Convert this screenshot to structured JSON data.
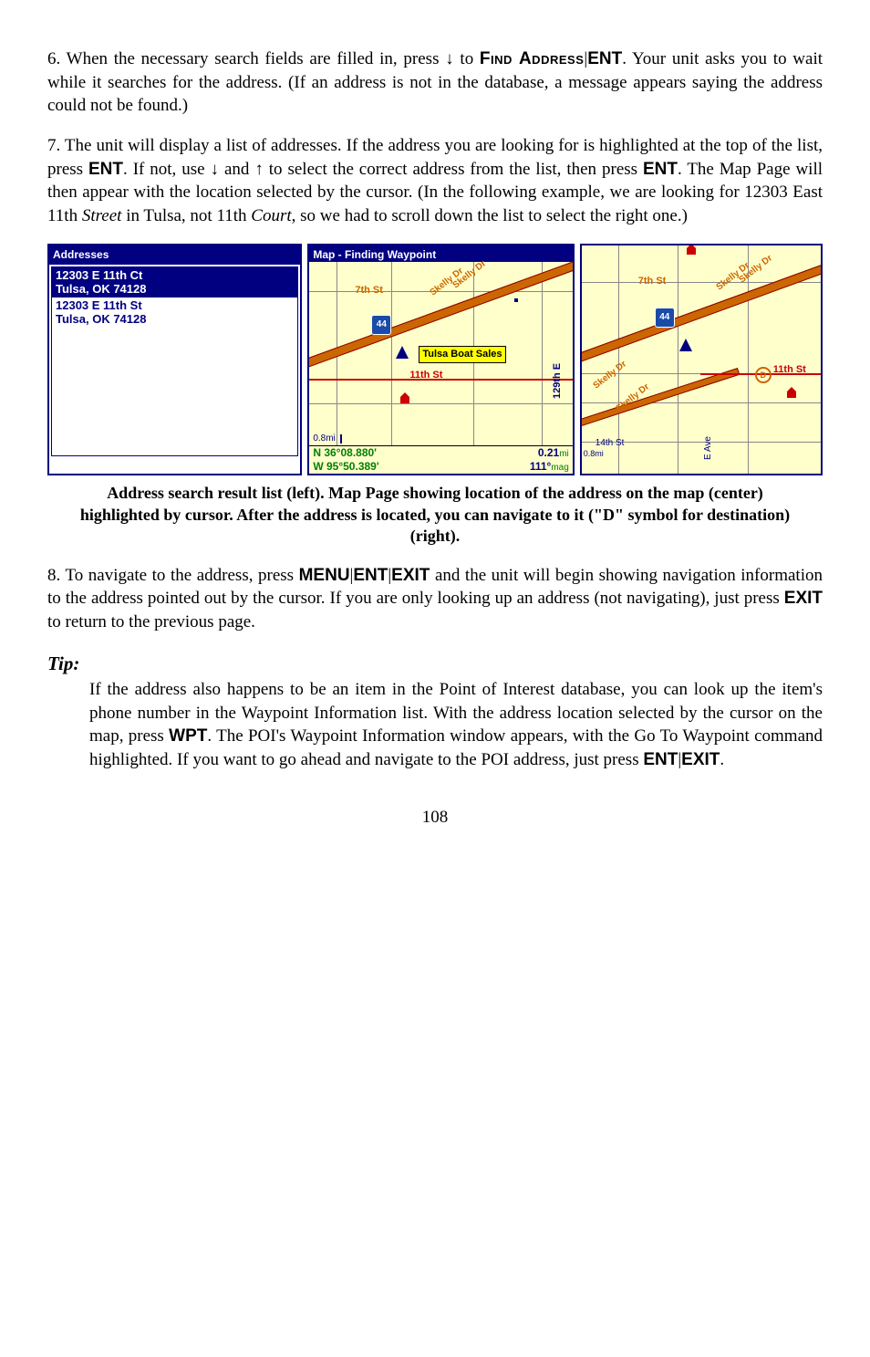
{
  "step6": {
    "prefix": "6. When the necessary search fields are filled in, press ↓ to ",
    "findaddress": "Find Address",
    "ent": "ENT",
    "rest": ". Your unit asks you to wait while it searches for the address. (If an address is not in the database, a message appears saying the address could not be found.)"
  },
  "step7": {
    "part1": "7. The unit will display a list of addresses. If the address you are looking for is highlighted at the top of the list, press ",
    "ent1": "ENT",
    "part2": ". If not, use ↓ and ↑ to select the correct address from the list, then press ",
    "ent2": "ENT",
    "part3": ". The Map Page will then appear with the location selected by the cursor. (In the following example, we are looking for 12303 East 11th ",
    "street": "Street",
    "part4": " in Tulsa, not 11th ",
    "court": "Court",
    "part5": ", so we had to scroll down the list to select the right one.)"
  },
  "fig": {
    "addr_title": "Addresses",
    "sel_line1": "12303 E 11th Ct",
    "sel_line2": "Tulsa, OK  74128",
    "unsel_line1": "12303 E 11th St",
    "unsel_line2": "Tulsa, OK  74128",
    "map_title": "Map - Finding Waypoint",
    "poi": "Tulsa Boat Sales",
    "street11": "11th St",
    "street129": "129th E",
    "street7": "7th St",
    "street14": "14th St",
    "skelly": "Skelly Dr",
    "eave": "E Ave",
    "shield": "44",
    "scale": "0.8mi",
    "coordN": "N    36°08.880'",
    "coordW": "W   95°50.389'",
    "dist": "0.21",
    "dist_unit": "mi",
    "bearing": "111°",
    "bearing_unit": "mag",
    "d_symbol": "D"
  },
  "caption": "Address search result list (left). Map Page showing location of the address on the map (center) highlighted by cursor. After the address is located, you can navigate to it (\"D\" symbol for destination) (right).",
  "step8": {
    "part1": "8. To navigate to the address, press ",
    "menu": "MENU",
    "ent": "ENT",
    "exit1": "EXIT",
    "part2": " and the unit will begin showing navigation information to the address pointed out by the cursor. If you are only looking up an address (not navigating), just press ",
    "exit2": "EXIT",
    "part3": " to return to the previous page."
  },
  "tip": {
    "head": "Tip:",
    "part1": "If the address also happens to be an item in the Point of Interest database, you can look up the item's phone number in the Waypoint Information list. With the address location selected by the cursor on the map, press ",
    "wpt": "WPT",
    "part2": ". The POI's Waypoint Information window appears, with the Go To Waypoint command highlighted. If you want to go ahead and navigate to the POI address, just press ",
    "ent": "ENT",
    "exit": "EXIT",
    "part3": "."
  },
  "page_num": "108"
}
